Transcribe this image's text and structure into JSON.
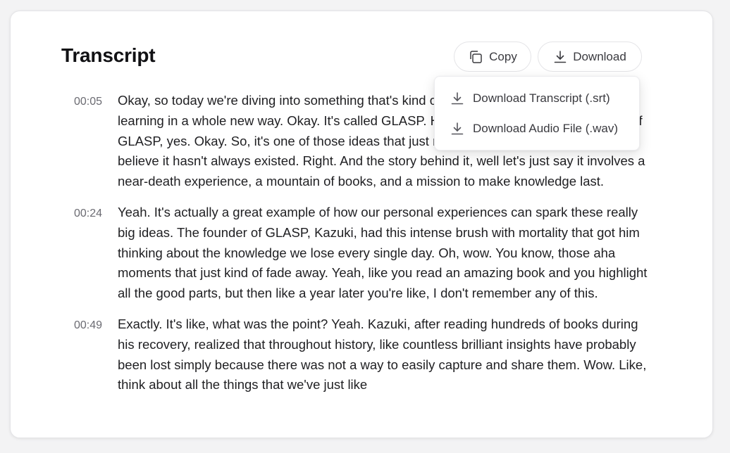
{
  "header": {
    "title": "Transcript",
    "copy_label": "Copy",
    "download_label": "Download"
  },
  "icons": {
    "copy": "copy-icon",
    "download": "download-icon"
  },
  "download_menu": {
    "items": [
      {
        "label": "Download Transcript (.srt)",
        "icon": "download-icon"
      },
      {
        "label": "Download Audio File (.wav)",
        "icon": "download-icon"
      }
    ]
  },
  "transcript": {
    "entries": [
      {
        "time": "00:05",
        "text": "Okay, so today we're diving into something that's kind of changing how we think about learning in a whole new way. Okay. It's called GLASP. Have you heard of it? The founder of GLASP, yes. Okay. So, it's one of those ideas that just makes so much sense, it's hard to believe it hasn't always existed. Right. And the story behind it, well let's just say it involves a near-death experience, a mountain of books, and a mission to make knowledge last."
      },
      {
        "time": "00:24",
        "text": "Yeah. It's actually a great example of how our personal experiences can spark these really big ideas. The founder of GLASP, Kazuki, had this intense brush with mortality that got him thinking about the knowledge we lose every single day. Oh, wow. You know, those aha moments that just kind of fade away. Yeah, like you read an amazing book and you highlight all the good parts, but then like a year later you're like, I don't remember any of this."
      },
      {
        "time": "00:49",
        "text": "Exactly. It's like, what was the point? Yeah. Kazuki, after reading hundreds of books during his recovery, realized that throughout history, like countless brilliant insights have probably been lost simply because there was not a way to easily capture and share them. Wow. Like, think about all the things that we've just like"
      }
    ]
  },
  "colors": {
    "text": "#1f1f22",
    "muted": "#6b6b72",
    "border": "#e4e4e7",
    "background": "#f3f3f4"
  }
}
